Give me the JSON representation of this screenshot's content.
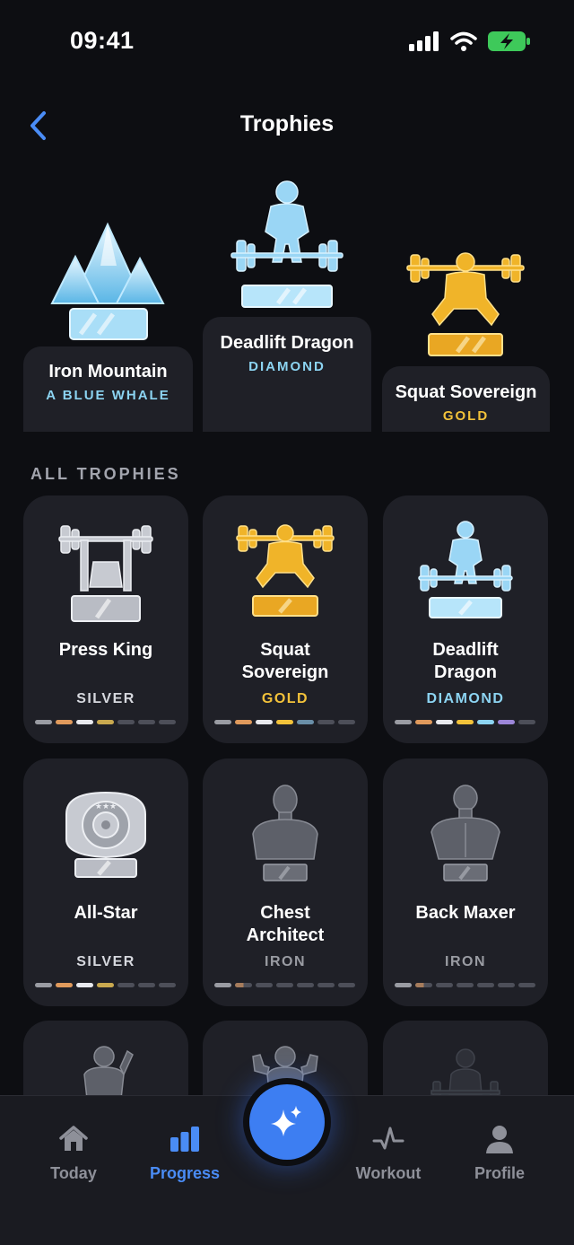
{
  "status": {
    "time": "09:41"
  },
  "header": {
    "title": "Trophies"
  },
  "podium": [
    {
      "name": "Iron Mountain",
      "tier": "A BLUE WHALE",
      "tier_color": "#8cd4f2"
    },
    {
      "name": "Deadlift Dragon",
      "tier": "DIAMOND",
      "tier_color": "#8cd4f2"
    },
    {
      "name": "Squat Sovereign",
      "tier": "GOLD",
      "tier_color": "#f2c23a"
    }
  ],
  "section": {
    "label": "ALL TROPHIES"
  },
  "trophies": [
    {
      "name": "Press King",
      "tier": "SILVER",
      "icon": "bench-press-trophy-icon"
    },
    {
      "name": "Squat Sovereign",
      "tier": "GOLD",
      "icon": "squat-trophy-icon"
    },
    {
      "name": "Deadlift Dragon",
      "tier": "DIAMOND",
      "icon": "deadlift-trophy-icon"
    },
    {
      "name": "All-Star",
      "tier": "SILVER",
      "icon": "medal-trophy-icon"
    },
    {
      "name": "Chest Architect",
      "tier": "IRON",
      "icon": "chest-bust-trophy-icon"
    },
    {
      "name": "Back Maxer",
      "tier": "IRON",
      "icon": "back-bust-trophy-icon"
    }
  ],
  "tier_progress_colors": [
    "#9a9ca3",
    "#e09a5c",
    "#e8e9ee",
    "#c9a94f",
    "#4d4f59",
    "#8cd4f2",
    "#9c86d9"
  ],
  "tabs": [
    {
      "label": "Today",
      "icon": "home-icon"
    },
    {
      "label": "Progress",
      "icon": "bar-chart-icon"
    },
    {
      "label": "Workout",
      "icon": "pulse-icon"
    },
    {
      "label": "Profile",
      "icon": "person-icon"
    }
  ]
}
